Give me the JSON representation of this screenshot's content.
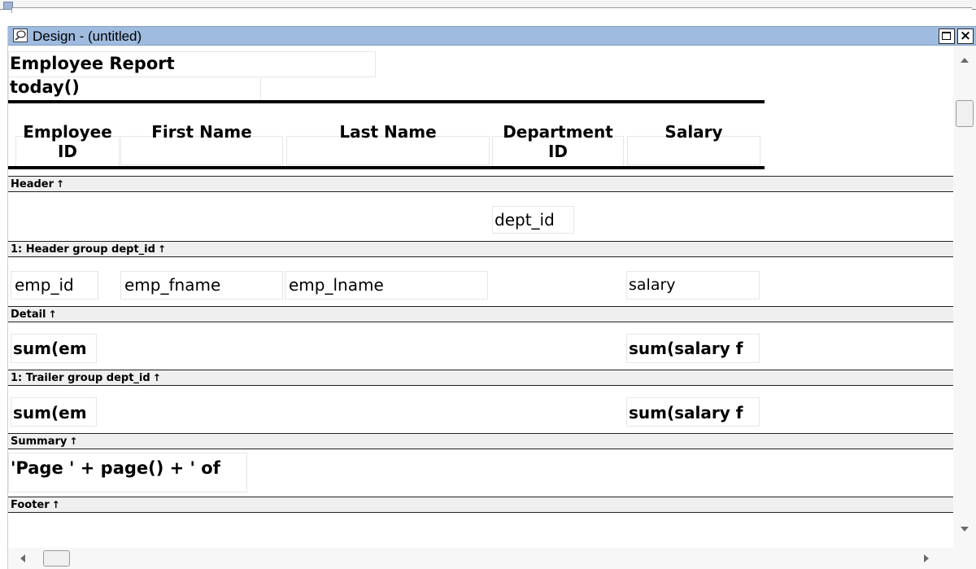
{
  "window": {
    "title": "Design - (untitled)",
    "maximize_label": "",
    "close_label": "×"
  },
  "report": {
    "title": "Employee Report",
    "date_expr": "today()",
    "column_headers": [
      {
        "line1": "Employee",
        "line2": "ID"
      },
      {
        "line1": "First Name",
        "line2": ""
      },
      {
        "line1": "Last Name",
        "line2": ""
      },
      {
        "line1": "Department",
        "line2": "ID"
      },
      {
        "line1": "Salary",
        "line2": ""
      }
    ]
  },
  "bands": {
    "header": "Header",
    "group_header": "1: Header group dept_id",
    "detail": "Detail",
    "group_trailer": "1: Trailer group dept_id",
    "summary": "Summary",
    "footer": "Footer",
    "arrow": "↑"
  },
  "fields": {
    "group_header_dept": "dept_id",
    "detail_emp_id": "emp_id",
    "detail_fname": "emp_fname",
    "detail_lname": "emp_lname",
    "detail_salary": "salary",
    "trailer_sum_emp": "sum(em",
    "trailer_sum_salary": "sum(salary f",
    "summary_sum_emp": "sum(em",
    "summary_sum_salary": "sum(salary f",
    "footer_page_expr": "'Page ' + page() + ' of"
  }
}
